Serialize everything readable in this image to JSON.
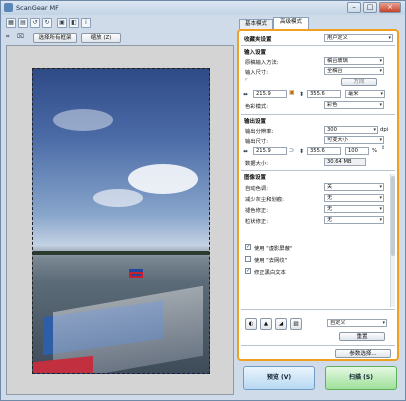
{
  "window": {
    "title": "ScanGear MF",
    "minimize": "–",
    "maximize": "□",
    "close": "×"
  },
  "toolbar": {
    "crop_all_label": "选择所有框架",
    "zoom_label": "缩放 (Z)"
  },
  "tabs": [
    {
      "label": "基本模式"
    },
    {
      "label": "高级模式"
    }
  ],
  "favorite": {
    "label": "收藏夹设置",
    "value": "用户定义"
  },
  "input": {
    "section": "输入设置",
    "paper_label": "原稿输入方法:",
    "paper_value": "稿台玻璃",
    "size_label": "输入尺寸:",
    "size_value": "全稿台",
    "orientation_label": "方向",
    "width": "215.9",
    "height": "355.6",
    "unit": "毫米",
    "color_label": "色彩模式:",
    "color_value": "彩色"
  },
  "output": {
    "section": "输出设置",
    "resolution_label": "输出分辨率:",
    "resolution_value": "300",
    "resolution_unit": "dpi",
    "size_label": "输出尺寸:",
    "size_value": "可变大小",
    "width": "215.9",
    "height": "355.6",
    "scale": "100",
    "scale_unit": "%",
    "datasize_label": "数据大小:",
    "datasize_value": "30.64 MB"
  },
  "image": {
    "section": "图像设置",
    "rows": [
      {
        "label": "自动色调:",
        "value": "关"
      },
      {
        "label": "减少灰尘和划痕:",
        "value": "无"
      },
      {
        "label": "褪色修正:",
        "value": "无"
      },
      {
        "label": "粒状修正:",
        "value": "无"
      }
    ],
    "checks": [
      {
        "label": "使用 \"虚影屏蔽\"",
        "checked": true
      },
      {
        "label": "使用 \"去网纹\"",
        "checked": false
      },
      {
        "label": "修正黑白文本",
        "checked": true
      }
    ]
  },
  "bottom": {
    "custom_value": "自定义",
    "reset_label": "重置",
    "prefs_label": "参数选择..."
  },
  "actions": {
    "preview_label": "预览 (V)",
    "scan_label": "扫描 (S)"
  }
}
